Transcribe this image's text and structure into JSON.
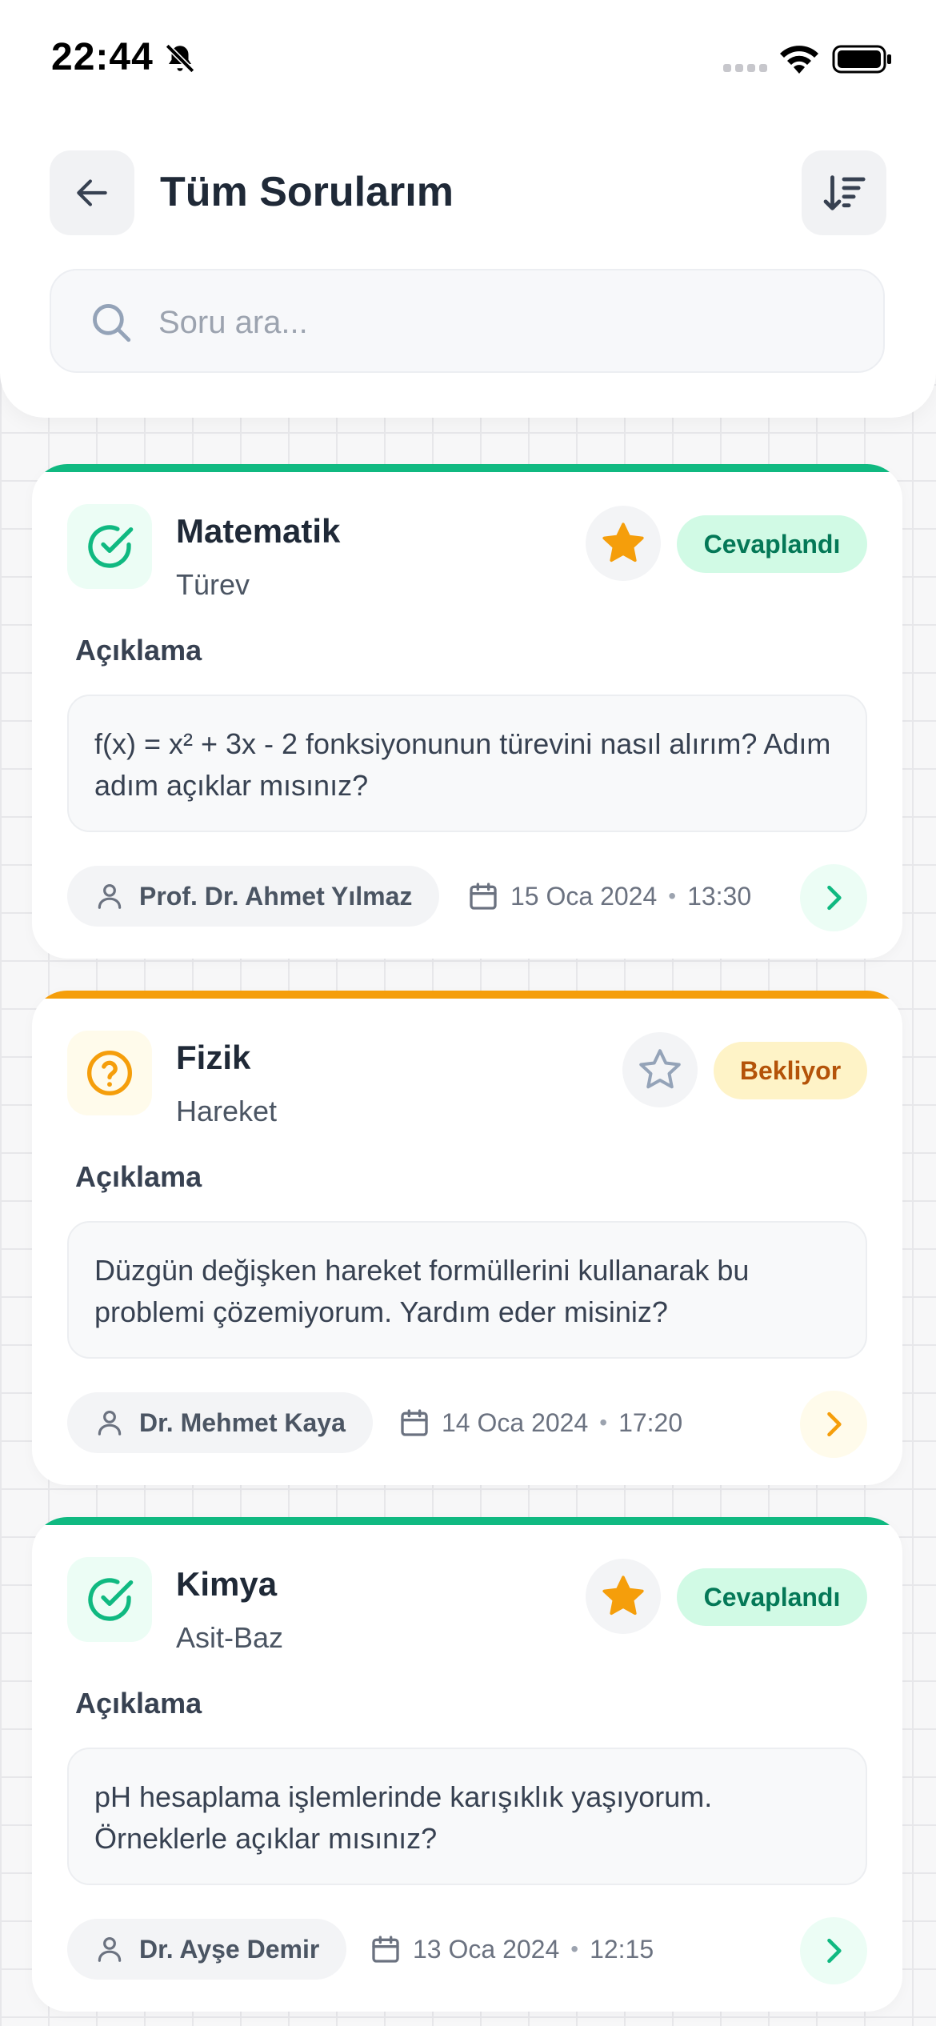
{
  "status_bar": {
    "time": "22:44"
  },
  "header": {
    "title": "Tüm Sorularım"
  },
  "search": {
    "placeholder": "Soru ara..."
  },
  "description_label": "Açıklama",
  "questions": [
    {
      "subject": "Matematik",
      "topic": "Türev",
      "status": "Cevaplandı",
      "status_type": "answered",
      "starred": true,
      "description": "f(x) = x² + 3x - 2 fonksiyonunun türevini nasıl alırım? Adım adım açıklar mısınız?",
      "teacher": "Prof. Dr. Ahmet Yılmaz",
      "date": "15 Oca 2024",
      "time": "13:30"
    },
    {
      "subject": "Fizik",
      "topic": "Hareket",
      "status": "Bekliyor",
      "status_type": "pending",
      "starred": false,
      "description": "Düzgün değişken hareket formüllerini kullanarak bu problemi çözemiyorum. Yardım eder misiniz?",
      "teacher": "Dr. Mehmet Kaya",
      "date": "14 Oca 2024",
      "time": "17:20"
    },
    {
      "subject": "Kimya",
      "topic": "Asit-Baz",
      "status": "Cevaplandı",
      "status_type": "answered",
      "starred": true,
      "description": "pH hesaplama işlemlerinde karışıklık yaşıyorum. Örneklerle açıklar mısınız?",
      "teacher": "Dr. Ayşe Demir",
      "date": "13 Oca 2024",
      "time": "12:15"
    }
  ],
  "colors": {
    "answered_accent": "#10b981",
    "answered_bg": "#d1fae5",
    "answered_text": "#047857",
    "pending_accent": "#f59e0b",
    "pending_bg": "#fef3c7",
    "pending_text": "#b45309",
    "star_filled": "#f59e0b",
    "star_empty": "#94a3b8"
  },
  "icons": {
    "back": "arrow-left-icon",
    "sort": "sort-descending-icon",
    "search": "search-icon",
    "answered": "check-circle-icon",
    "pending": "question-circle-icon",
    "star": "star-icon",
    "teacher": "user-icon",
    "date": "calendar-icon",
    "go": "chevron-right-icon"
  }
}
